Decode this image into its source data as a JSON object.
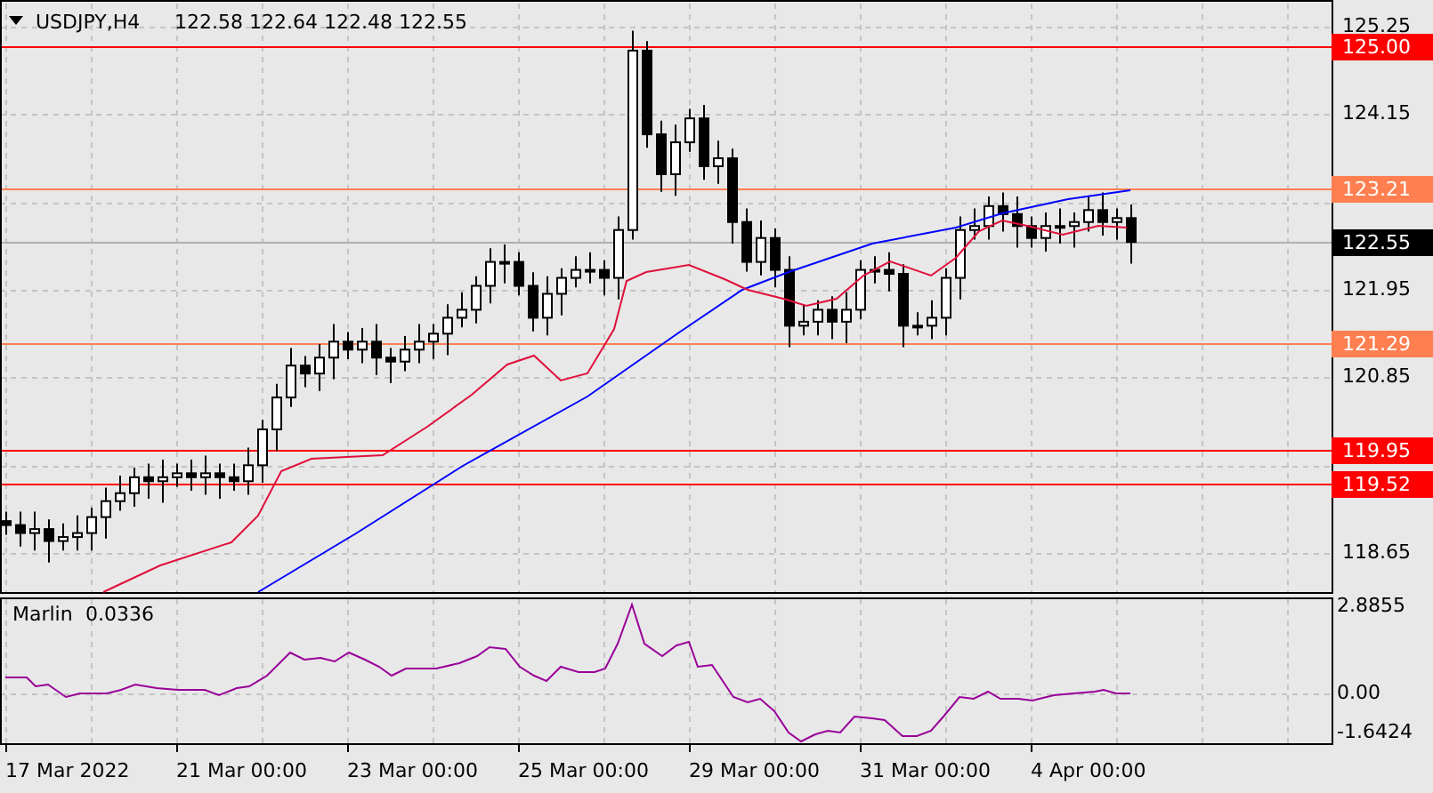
{
  "header": {
    "symbol": "USDJPY,H4",
    "ohlc": "122.58 122.64 122.48 122.55"
  },
  "price_axis": {
    "ticks": [
      "125.25",
      "124.15",
      "121.95",
      "120.85",
      "118.65"
    ]
  },
  "levels": [
    {
      "label": "125.00",
      "color": "#ff0000"
    },
    {
      "label": "123.21",
      "color": "#ff7f50"
    },
    {
      "label": "121.29",
      "color": "#ff7f50"
    },
    {
      "label": "119.95",
      "color": "#ff0000"
    },
    {
      "label": "119.52",
      "color": "#ff0000"
    }
  ],
  "current_price": {
    "label": "122.55"
  },
  "indicator": {
    "name": "Marlin",
    "value": "0.0336",
    "ticks": [
      "2.8855",
      "0.00",
      "-1.6424"
    ]
  },
  "time_axis": {
    "labels": [
      "17 Mar 2022",
      "21 Mar 00:00",
      "23 Mar 00:00",
      "25 Mar 00:00",
      "29 Mar 00:00",
      "31 Mar 00:00",
      "4 Apr 00:00"
    ]
  }
}
